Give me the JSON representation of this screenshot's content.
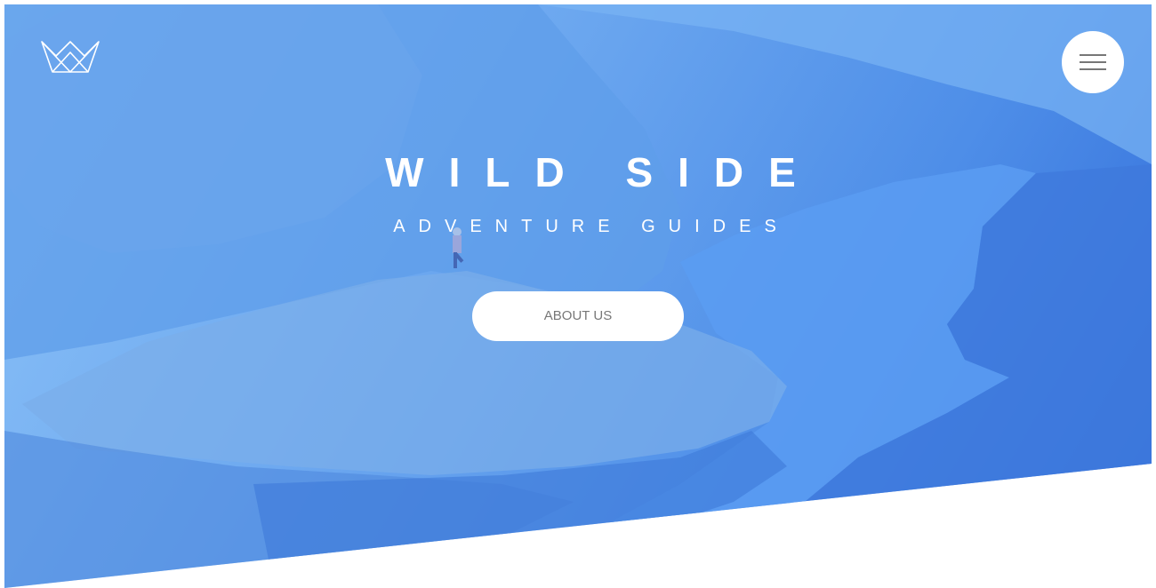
{
  "header": {
    "logo_icon": "crown-icon",
    "menu_icon": "hamburger-menu-icon"
  },
  "hero": {
    "title": "WILD SIDE",
    "subtitle": "ADVENTURE GUIDES",
    "cta_label": "ABOUT US",
    "overlay_colors": [
      "#8cc2f7",
      "#4e8ee8",
      "#2f6ad8"
    ]
  }
}
